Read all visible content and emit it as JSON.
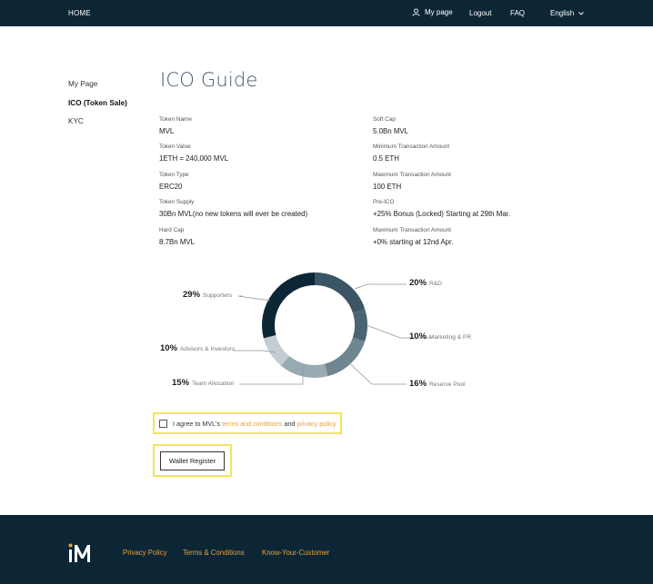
{
  "nav": {
    "home": "HOME",
    "mypage": "My page",
    "logout": "Logout",
    "faq": "FAQ",
    "language": "English"
  },
  "sidebar": {
    "items": [
      {
        "label": "My Page"
      },
      {
        "label": "ICO (Token Sale)"
      },
      {
        "label": "KYC"
      }
    ]
  },
  "page": {
    "title": "ICO Guide"
  },
  "info": {
    "left": [
      {
        "label": "Token Name",
        "value": "MVL"
      },
      {
        "label": "Token Value",
        "value": "1ETH = 240,000 MVL"
      },
      {
        "label": "Token Type",
        "value": "ERC20"
      },
      {
        "label": "Token Supply",
        "value": "30Bn MVL(no new tokens will ever be created)"
      },
      {
        "label": "Hard Cap",
        "value": "8.7Bn MVL"
      }
    ],
    "right": [
      {
        "label": "Soft Cap",
        "value": "5.0Bn MVL"
      },
      {
        "label": "Minimum Transaction Amount",
        "value": "0.5 ETH"
      },
      {
        "label": "Maximum Transaction Amount",
        "value": "100 ETH"
      },
      {
        "label": "Pre-ICO",
        "value": "+25% Bonus (Locked) Starting at 29th Mar."
      },
      {
        "label": "Maximum Transaction Amount",
        "value": "+0% starting at 12nd Apr."
      }
    ]
  },
  "chart_data": {
    "type": "pie",
    "slices": [
      {
        "name": "R&D",
        "percent": "20%",
        "value": 20,
        "color": "#3b5564"
      },
      {
        "name": "Marketing & PR",
        "percent": "10%",
        "value": 10,
        "color": "#4b6471"
      },
      {
        "name": "Reserve Pool",
        "percent": "16%",
        "value": 16,
        "color": "#6f858f"
      },
      {
        "name": "Team Allocation",
        "percent": "15%",
        "value": 15,
        "color": "#9aaab2"
      },
      {
        "name": "Advisors & Investors",
        "percent": "10%",
        "value": 10,
        "color": "#c3cdd2"
      },
      {
        "name": "Supporters",
        "percent": "29%",
        "value": 29,
        "color": "#0c2636"
      }
    ]
  },
  "agreement": {
    "prefix": "I agree to MVL's ",
    "terms_link": "terms and conditions",
    "middle": " and ",
    "privacy_link": "privacy policy"
  },
  "actions": {
    "wallet_register": "Wallet Register"
  },
  "footer": {
    "links": [
      {
        "label": "Privacy Policy"
      },
      {
        "label": "Terms & Conditions"
      },
      {
        "label": "Know-Your-Customer"
      }
    ]
  }
}
